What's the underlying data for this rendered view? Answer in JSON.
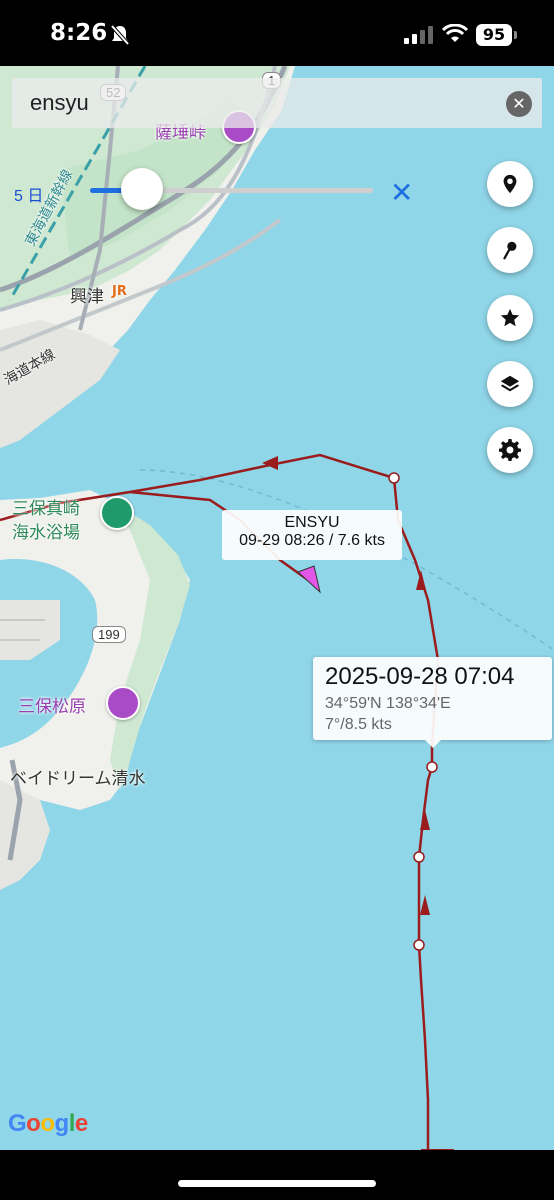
{
  "status_bar": {
    "time": "8:26",
    "battery": "95"
  },
  "search": {
    "query": "ensyu"
  },
  "slider": {
    "label": "5 日",
    "value_fraction": 0.18
  },
  "vessel": {
    "name": "ENSYU",
    "info": "09-29 08:26 / 7.6 kts"
  },
  "track_point": {
    "datetime": "2025-09-28 07:04",
    "position": "34°59'N 138°34'E",
    "course_speed": "7°/8.5 kts"
  },
  "map_labels": {
    "satta_pass": "薩埵峠",
    "okitsu": "興津",
    "tokaido_shinkansen": "東海道新幹線",
    "tokaido_line": "海道本線",
    "miho_beach_line1": "三保真崎",
    "miho_beach_line2": "海水浴場",
    "miho_matsubara": "三保松原",
    "bay_dream": "ベイドリーム清水",
    "route_52": "52",
    "route_1": "1",
    "route_199": "199",
    "jr": "JR",
    "google": "Google"
  },
  "fab_buttons": [
    "location-pin-icon",
    "pushpin-icon",
    "star-icon",
    "layers-icon",
    "settings-icon"
  ],
  "colors": {
    "sea": "#8fd3e6",
    "land": "#f1f1ee",
    "track": "#9a1c1c",
    "vessel": "#e257e8",
    "accent": "#1e6fe0"
  }
}
